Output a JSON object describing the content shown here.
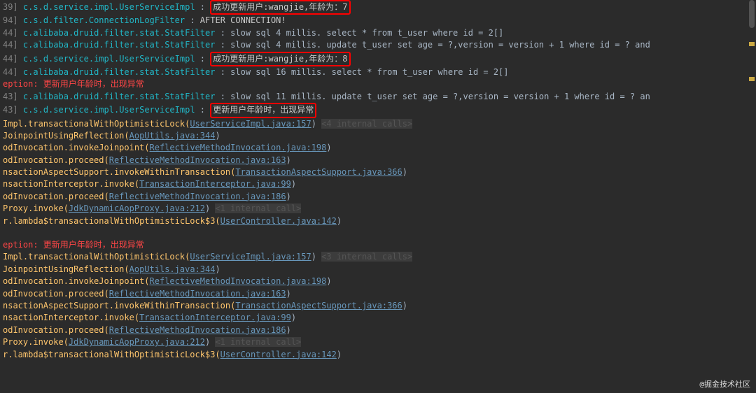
{
  "lines": {
    "l0_ln": "39]",
    "l0_pkg": "c.s.d.service.impl.UserServiceImpl",
    "l0_mid": "          : ",
    "l0_msg": "成功更新用户:wangjie,年龄为：7",
    "l1_ln": "94]",
    "l1_pkg": "c.s.d.filter.ConnectionLogFilter",
    "l1_mid": "            : ",
    "l1_msg": "AFTER CONNECTION!",
    "l2_ln": "44]",
    "l2_pkg": "c.alibaba.druid.filter.stat.StatFilter",
    "l2_mid": "      : ",
    "l2_msg": "slow sql 4 millis. select * from t_user where id = 2[]",
    "l3_ln": "44]",
    "l3_pkg": "c.alibaba.druid.filter.stat.StatFilter",
    "l3_mid": "      : ",
    "l3_msg": "slow sql 4 millis. update t_user set age = ?,version = version + 1  where id = ?  and",
    "l4_ln": "44]",
    "l4_pkg": "c.s.d.service.impl.UserServiceImpl",
    "l4_mid": "          : ",
    "l4_msg": "成功更新用户:wangjie,年龄为：8",
    "l5_ln": "44]",
    "l5_pkg": "c.alibaba.druid.filter.stat.StatFilter",
    "l5_mid": "      : ",
    "l5_msg": "slow sql 16 millis. select * from t_user where id = 2[]",
    "l6_msg": "eption: 更新用户年龄时，出现异常",
    "l7_ln": "43]",
    "l7_pkg": "c.alibaba.druid.filter.stat.StatFilter",
    "l7_mid": "      : ",
    "l7_msg": "slow sql 11 millis. update t_user set age = ?,version = version + 1  where id = ?  an",
    "l8_ln": "43]",
    "l8_pkg": "c.s.d.service.impl.UserServiceImpl",
    "l8_mid": "          : ",
    "l8_msg": "更新用户年龄时，出现异常",
    "st0a": "Impl.transactionalWithOptimisticLock(",
    "st0l": "UserServiceImpl.java:157",
    "st0b": ") ",
    "st0d": "<4 internal calls>",
    "st1a": "JoinpointUsingReflection(",
    "st1l": "AopUtils.java:344",
    "st1b": ")",
    "st2a": "odInvocation.invokeJoinpoint(",
    "st2l": "ReflectiveMethodInvocation.java:198",
    "st2b": ")",
    "st3a": "odInvocation.proceed(",
    "st3l": "ReflectiveMethodInvocation.java:163",
    "st3b": ")",
    "st4a": "nsactionAspectSupport.invokeWithinTransaction(",
    "st4l": "TransactionAspectSupport.java:366",
    "st4b": ")",
    "st5a": "nsactionInterceptor.invoke(",
    "st5l": "TransactionInterceptor.java:99",
    "st5b": ")",
    "st6a": "odInvocation.proceed(",
    "st6l": "ReflectiveMethodInvocation.java:186",
    "st6b": ")",
    "st7a": "Proxy.invoke(",
    "st7l": "JdkDynamicAopProxy.java:212",
    "st7b": ") ",
    "st7d": "<1 internal call>",
    "st8a": "r.lambda$transactionalWithOptimisticLock$3(",
    "st8l": "UserController.java:142",
    "st8b": ")",
    "l9_msg": "eption: 更新用户年龄时，出现异常",
    "st10a": "Impl.transactionalWithOptimisticLock(",
    "st10l": "UserServiceImpl.java:157",
    "st10b": ") ",
    "st10d": "<3 internal calls>",
    "st11a": "JoinpointUsingReflection(",
    "st11l": "AopUtils.java:344",
    "st11b": ")",
    "st12a": "odInvocation.invokeJoinpoint(",
    "st12l": "ReflectiveMethodInvocation.java:198",
    "st12b": ")",
    "st13a": "odInvocation.proceed(",
    "st13l": "ReflectiveMethodInvocation.java:163",
    "st13b": ")",
    "st14a": "nsactionAspectSupport.invokeWithinTransaction(",
    "st14l": "TransactionAspectSupport.java:366",
    "st14b": ")",
    "st15a": "nsactionInterceptor.invoke(",
    "st15l": "TransactionInterceptor.java:99",
    "st15b": ")",
    "st16a": "odInvocation.proceed(",
    "st16l": "ReflectiveMethodInvocation.java:186",
    "st16b": ")",
    "st17a": "Proxy.invoke(",
    "st17l": "JdkDynamicAopProxy.java:212",
    "st17b": ") ",
    "st17d": "<1 internal call>",
    "st18a": "r.lambda$transactionalWithOptimisticLock$3(",
    "st18l": "UserController.java:142",
    "st18b": ")"
  },
  "watermark": "@掘金技术社区"
}
